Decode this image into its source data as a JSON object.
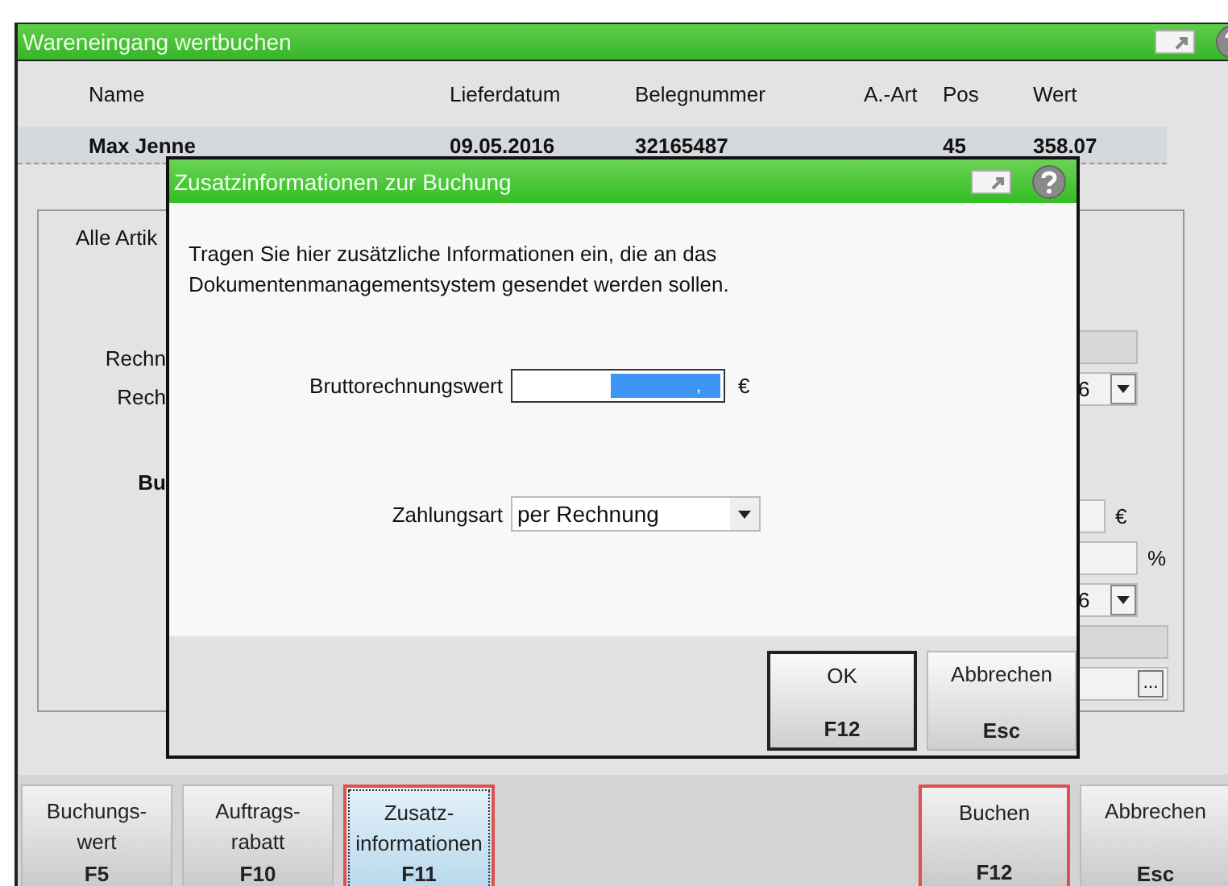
{
  "window": {
    "title": "Wareneingang wertbuchen"
  },
  "table": {
    "columns": [
      "Name",
      "Lieferdatum",
      "Belegnummer",
      "A.-Art",
      "Pos",
      "Wert"
    ],
    "rows": [
      {
        "cells": [
          "Max Jenne",
          "09.05.2016",
          "32165487",
          null,
          "45",
          "358.07"
        ]
      }
    ]
  },
  "background_panel": {
    "tab": "Alle Artik",
    "labels": [
      {
        "text": "Rechn",
        "kind": "plain"
      },
      {
        "text": "Rech",
        "kind": "plain"
      },
      {
        "text": "Bu",
        "kind": "bold"
      }
    ],
    "fields": [
      {
        "kind": "readonly"
      },
      {
        "kind": "dropdown",
        "value": "6"
      },
      {
        "kind": "input",
        "unit": "€"
      },
      {
        "kind": "input",
        "unit": "%"
      },
      {
        "kind": "dropdown",
        "value": "6"
      },
      {
        "kind": "readonly"
      },
      {
        "kind": "browse",
        "button": "..."
      }
    ]
  },
  "dialog": {
    "title": "Zusatzinformationen zur Buchung",
    "message": "Tragen Sie hier zusätzliche Informationen ein, die an das Dokumentenmanagementsystem gesendet werden sollen.",
    "fields": [
      {
        "label": "Bruttorechnungswert",
        "kind": "amount",
        "value": ",",
        "text_selected": true,
        "unit": "€"
      },
      {
        "label": "Zahlungsart",
        "kind": "select",
        "value": "per Rechnung"
      }
    ],
    "buttons": [
      {
        "label": "OK",
        "key": "F12",
        "default": true
      },
      {
        "label": "Abbrechen",
        "key": "Esc",
        "default": false
      }
    ]
  },
  "toolbar_left": [
    {
      "lines": [
        "Buchungs-",
        "wert"
      ],
      "key": "F5",
      "focused": false,
      "highlighted": false
    },
    {
      "lines": [
        "Auftrags-",
        "rabatt"
      ],
      "key": "F10",
      "focused": false,
      "highlighted": false
    },
    {
      "lines": [
        "Zusatz-",
        "informationen"
      ],
      "key": "F11",
      "focused": true,
      "highlighted": true
    }
  ],
  "toolbar_right": [
    {
      "lines": [
        "Buchen"
      ],
      "key": "F12",
      "focused": false,
      "highlighted": true
    },
    {
      "lines": [
        "Abbrechen"
      ],
      "key": "Esc",
      "focused": false,
      "highlighted": false
    }
  ]
}
